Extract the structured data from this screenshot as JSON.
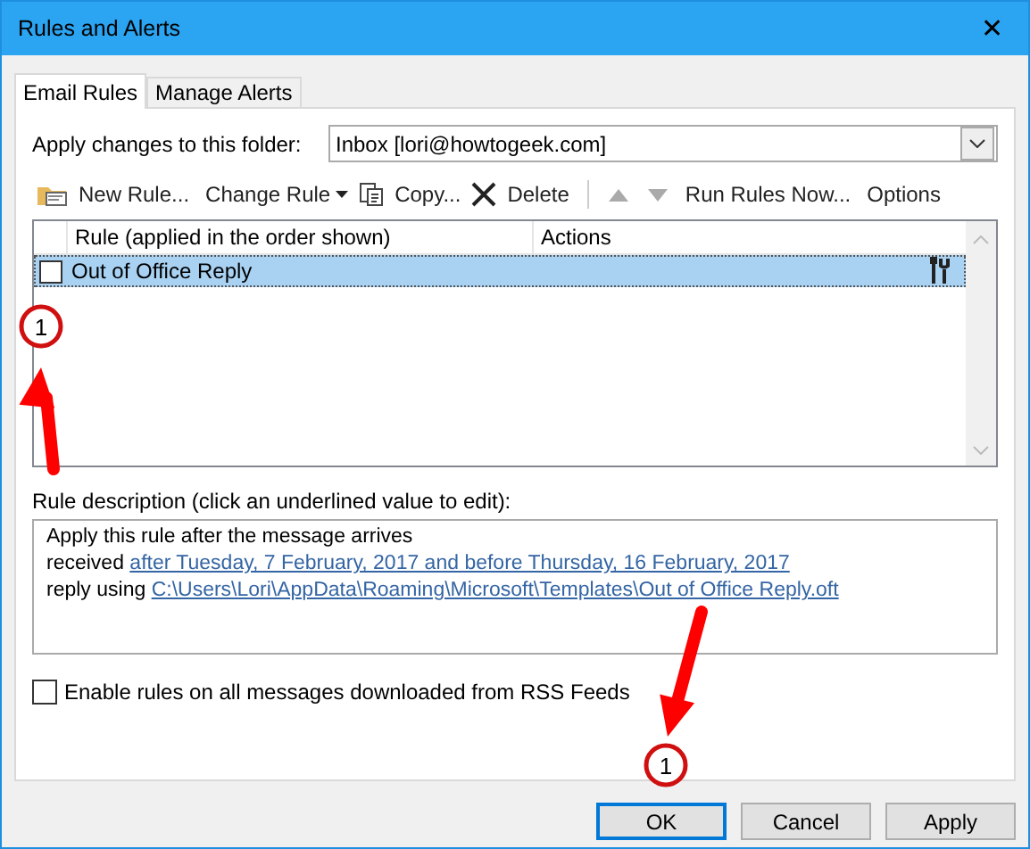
{
  "window": {
    "title": "Rules and Alerts",
    "close": "✕"
  },
  "tabs": [
    {
      "label": "Email Rules",
      "selected": true
    },
    {
      "label": "Manage Alerts",
      "selected": false
    }
  ],
  "folder": {
    "label": "Apply changes to this folder:",
    "value": "Inbox [lori@howtogeek.com]"
  },
  "toolbar": [
    {
      "kind": "new",
      "label": "New Rule...",
      "disabled": false
    },
    {
      "kind": "change",
      "label": "Change Rule",
      "disabled": false
    },
    {
      "kind": "copy",
      "label": "Copy...",
      "disabled": false
    },
    {
      "kind": "delete",
      "label": "Delete",
      "disabled": false
    },
    {
      "kind": "up",
      "disabled": true
    },
    {
      "kind": "down",
      "disabled": true
    },
    {
      "kind": "text",
      "label": "Run Rules Now...",
      "disabled": false
    },
    {
      "kind": "text",
      "label": "Options",
      "disabled": false
    }
  ],
  "table": {
    "columns": [
      "Rule (applied in the order shown)",
      "Actions"
    ],
    "rows": [
      {
        "name": "Out of Office Reply",
        "checked": false,
        "selected": true
      }
    ]
  },
  "description": {
    "label": "Rule description (click an underlined value to edit):",
    "lines": [
      {
        "text": "Apply this rule after the message arrives"
      },
      {
        "text": "received ",
        "link": "after Tuesday, 7 February, 2017 and before Thursday, 16 February, 2017"
      },
      {
        "text": "reply using ",
        "link": "C:\\Users\\Lori\\AppData\\Roaming\\Microsoft\\Templates\\Out of Office Reply.oft"
      }
    ]
  },
  "rss": {
    "label": "Enable rules on all messages downloaded from RSS Feeds",
    "checked": false
  },
  "buttons": [
    {
      "label": "OK",
      "default": true
    },
    {
      "label": "Cancel",
      "default": false
    },
    {
      "label": "Apply",
      "default": false
    }
  ],
  "annotations": [
    {
      "label": "1"
    },
    {
      "label": "1"
    }
  ]
}
